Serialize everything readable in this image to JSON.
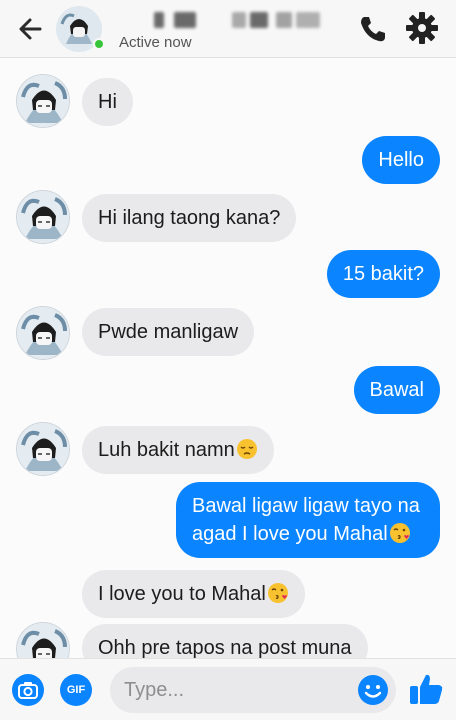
{
  "header": {
    "status": "Active now",
    "online": true
  },
  "messages": [
    {
      "side": "in",
      "text": "Hi"
    },
    {
      "side": "out",
      "text": "Hello"
    },
    {
      "side": "in",
      "text": "Hi ilang taong kana?"
    },
    {
      "side": "out",
      "text": "15 bakit?"
    },
    {
      "side": "in",
      "text": "Pwde manligaw"
    },
    {
      "side": "out",
      "text": "Bawal"
    },
    {
      "side": "in",
      "text": "Luh bakit namn",
      "emoji": "pensive-face-emoji"
    },
    {
      "side": "out",
      "text_line1": "Bawal ligaw ligaw tayo na",
      "text_line2": "agad I love you Mahal",
      "emoji": "face-blowing-kiss-emoji"
    },
    {
      "side": "in",
      "text": "I love you to Mahal",
      "emoji": "face-blowing-kiss-emoji"
    },
    {
      "side": "in",
      "text": "Ohh pre tapos na post muna"
    }
  ],
  "composer": {
    "gif_label": "GIF",
    "placeholder": "Type..."
  },
  "colors": {
    "accent": "#0a84ff",
    "incoming_bubble": "#e9e9eb",
    "online": "#38c43a"
  },
  "icons": [
    "back-arrow-icon",
    "phone-icon",
    "gear-icon",
    "camera-icon",
    "smiley-icon",
    "thumbs-up-icon"
  ]
}
